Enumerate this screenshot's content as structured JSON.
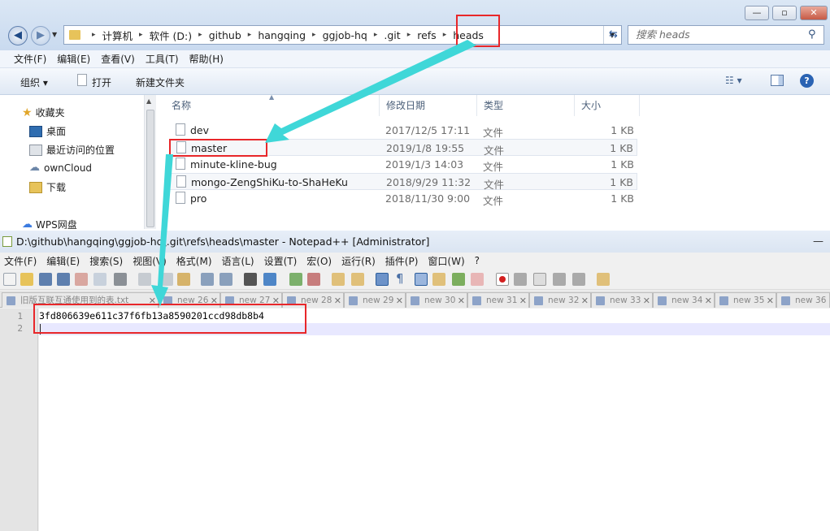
{
  "explorer": {
    "breadcrumbs": [
      "计算机",
      "软件 (D:)",
      "github",
      "hangqing",
      "ggjob-hq",
      ".git",
      "refs",
      "heads"
    ],
    "search_placeholder": "搜索 heads",
    "menu": [
      "文件(F)",
      "编辑(E)",
      "查看(V)",
      "工具(T)",
      "帮助(H)"
    ],
    "toolbar": {
      "organize": "组织",
      "open": "打开",
      "new_folder": "新建文件夹"
    },
    "nav": [
      {
        "label": "收藏夹",
        "icon": "star-icon"
      },
      {
        "label": "桌面",
        "icon": "desktop-icon"
      },
      {
        "label": "最近访问的位置",
        "icon": "recent-places-icon"
      },
      {
        "label": "ownCloud",
        "icon": "cloud-icon"
      },
      {
        "label": "下载",
        "icon": "download-folder-icon"
      },
      {
        "label": "WPS网盘",
        "icon": "wps-cloud-icon"
      }
    ],
    "columns": [
      "名称",
      "修改日期",
      "类型",
      "大小"
    ],
    "files": [
      {
        "name": "dev",
        "date": "2017/12/5 17:11",
        "type": "文件",
        "size": "1 KB"
      },
      {
        "name": "master",
        "date": "2019/1/8 19:55",
        "type": "文件",
        "size": "1 KB"
      },
      {
        "name": "minute-kline-bug",
        "date": "2019/1/3 14:03",
        "type": "文件",
        "size": "1 KB"
      },
      {
        "name": "mongo-ZengShiKu-to-ShaHeKu",
        "date": "2018/9/29 11:32",
        "type": "文件",
        "size": "1 KB"
      },
      {
        "name": "pro",
        "date": "2018/11/30 9:00",
        "type": "文件",
        "size": "1 KB"
      }
    ]
  },
  "notepad": {
    "title": "D:\\github\\hangqing\\ggjob-hq\\.git\\refs\\heads\\master - Notepad++ [Administrator]",
    "menu": [
      "文件(F)",
      "编辑(E)",
      "搜索(S)",
      "视图(V)",
      "格式(M)",
      "语言(L)",
      "设置(T)",
      "宏(O)",
      "运行(R)",
      "插件(P)",
      "窗口(W)",
      "?"
    ],
    "tabs": [
      "旧版互联互通使用到的表.txt",
      "new 26",
      "new 27",
      "new 28",
      "new 29",
      "new 30",
      "new 31",
      "new 32",
      "new 33",
      "new 34",
      "new 35",
      "new 36"
    ],
    "lines": [
      "1",
      "2"
    ],
    "content": "3fd806639e611c37f6fb13a8590201ccd98db8b4"
  },
  "colors": {
    "highlight_box": "#e8272a",
    "arrow": "#3fd7d8"
  }
}
